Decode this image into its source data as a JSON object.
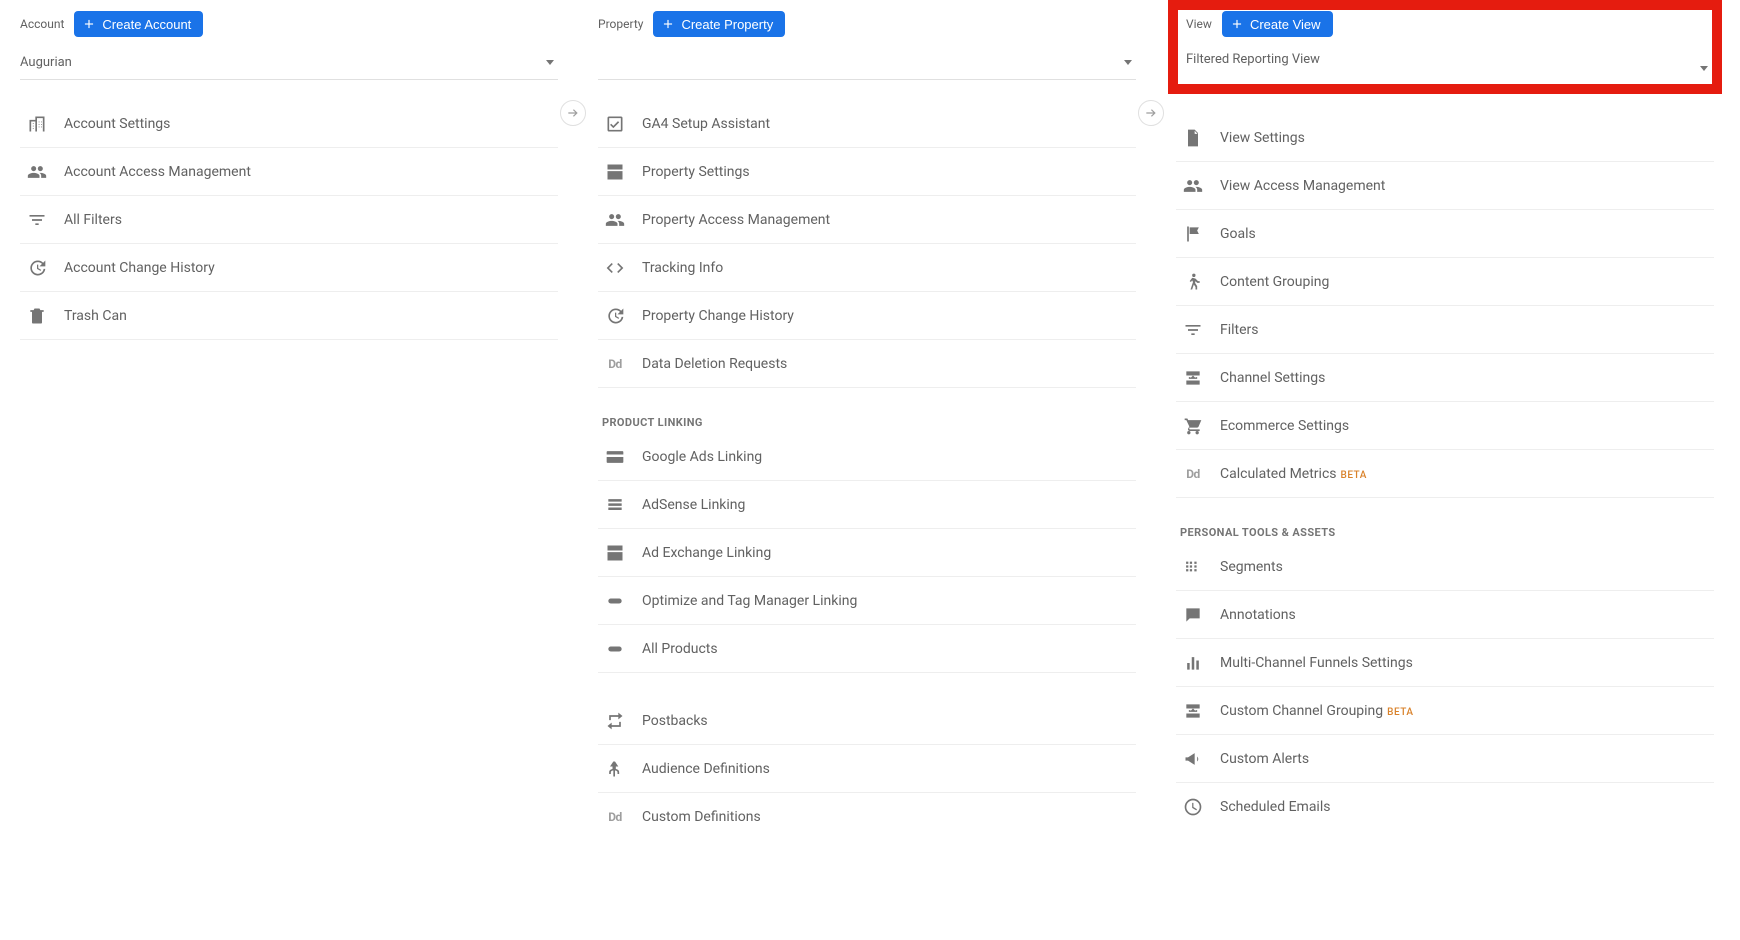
{
  "account": {
    "label": "Account",
    "create_btn": "Create Account",
    "selected": "Augurian",
    "items": [
      {
        "icon": "building",
        "label": "Account Settings"
      },
      {
        "icon": "people",
        "label": "Account Access Management"
      },
      {
        "icon": "filter",
        "label": "All Filters"
      },
      {
        "icon": "history",
        "label": "Account Change History"
      },
      {
        "icon": "trash",
        "label": "Trash Can"
      }
    ]
  },
  "property": {
    "label": "Property",
    "create_btn": "Create Property",
    "selected": "",
    "items": [
      {
        "icon": "checkbox",
        "label": "GA4 Setup Assistant"
      },
      {
        "icon": "layout",
        "label": "Property Settings"
      },
      {
        "icon": "people",
        "label": "Property Access Management"
      },
      {
        "icon": "code",
        "label": "Tracking Info"
      },
      {
        "icon": "history",
        "label": "Property Change History"
      },
      {
        "icon": "dd",
        "label": "Data Deletion Requests"
      }
    ],
    "section_product_linking": "PRODUCT LINKING",
    "product_linking": [
      {
        "icon": "card",
        "label": "Google Ads Linking"
      },
      {
        "icon": "list",
        "label": "AdSense Linking"
      },
      {
        "icon": "layout",
        "label": "Ad Exchange Linking"
      },
      {
        "icon": "link",
        "label": "Optimize and Tag Manager Linking"
      },
      {
        "icon": "link",
        "label": "All Products"
      }
    ],
    "extras": [
      {
        "icon": "swap",
        "label": "Postbacks"
      },
      {
        "icon": "branch",
        "label": "Audience Definitions"
      },
      {
        "icon": "dd",
        "label": "Custom Definitions"
      }
    ]
  },
  "view": {
    "label": "View",
    "create_btn": "Create View",
    "selected": "Filtered Reporting View",
    "items": [
      {
        "icon": "page",
        "label": "View Settings"
      },
      {
        "icon": "people",
        "label": "View Access Management"
      },
      {
        "icon": "flag",
        "label": "Goals"
      },
      {
        "icon": "person-walk",
        "label": "Content Grouping"
      },
      {
        "icon": "filter",
        "label": "Filters"
      },
      {
        "icon": "channel",
        "label": "Channel Settings"
      },
      {
        "icon": "cart",
        "label": "Ecommerce Settings"
      },
      {
        "icon": "dd",
        "label": "Calculated Metrics",
        "badge": "BETA"
      }
    ],
    "section_personal": "PERSONAL TOOLS & ASSETS",
    "personal": [
      {
        "icon": "segments",
        "label": "Segments"
      },
      {
        "icon": "comment",
        "label": "Annotations"
      },
      {
        "icon": "bars",
        "label": "Multi-Channel Funnels Settings"
      },
      {
        "icon": "channel",
        "label": "Custom Channel Grouping",
        "badge": "BETA"
      },
      {
        "icon": "megaphone",
        "label": "Custom Alerts"
      },
      {
        "icon": "clock",
        "label": "Scheduled Emails"
      }
    ]
  }
}
